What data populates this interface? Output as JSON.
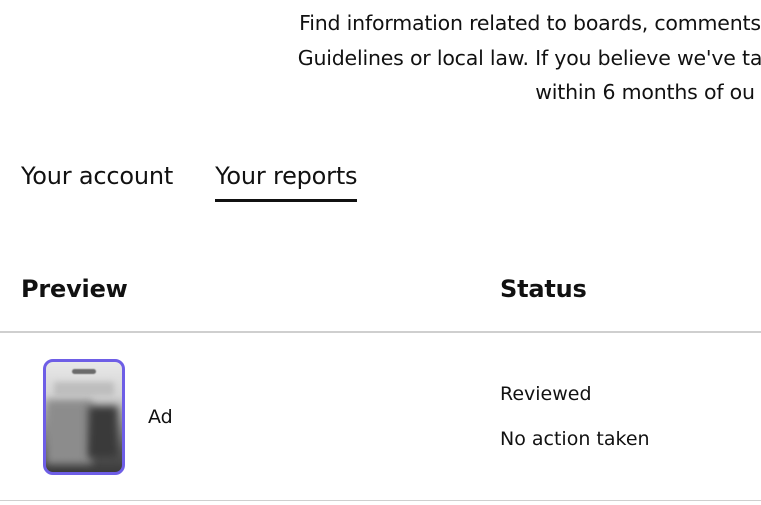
{
  "intro": {
    "lines": [
      "Find information related to boards, comments",
      "Guidelines or local law. If you believe we've ta",
      "within 6 months of ou"
    ]
  },
  "tabs": [
    {
      "label": "Your account",
      "active": false
    },
    {
      "label": "Your reports",
      "active": true
    }
  ],
  "table": {
    "headers": {
      "preview": "Preview",
      "status": "Status"
    },
    "rows": [
      {
        "label": "Ad",
        "status": "Reviewed",
        "status_detail": "No action taken",
        "thumbnail_icon": "ad-thumbnail"
      }
    ]
  },
  "colors": {
    "thumbnail_border": "#6e5ee6",
    "text": "#111111",
    "divider": "#cfcfcf"
  }
}
